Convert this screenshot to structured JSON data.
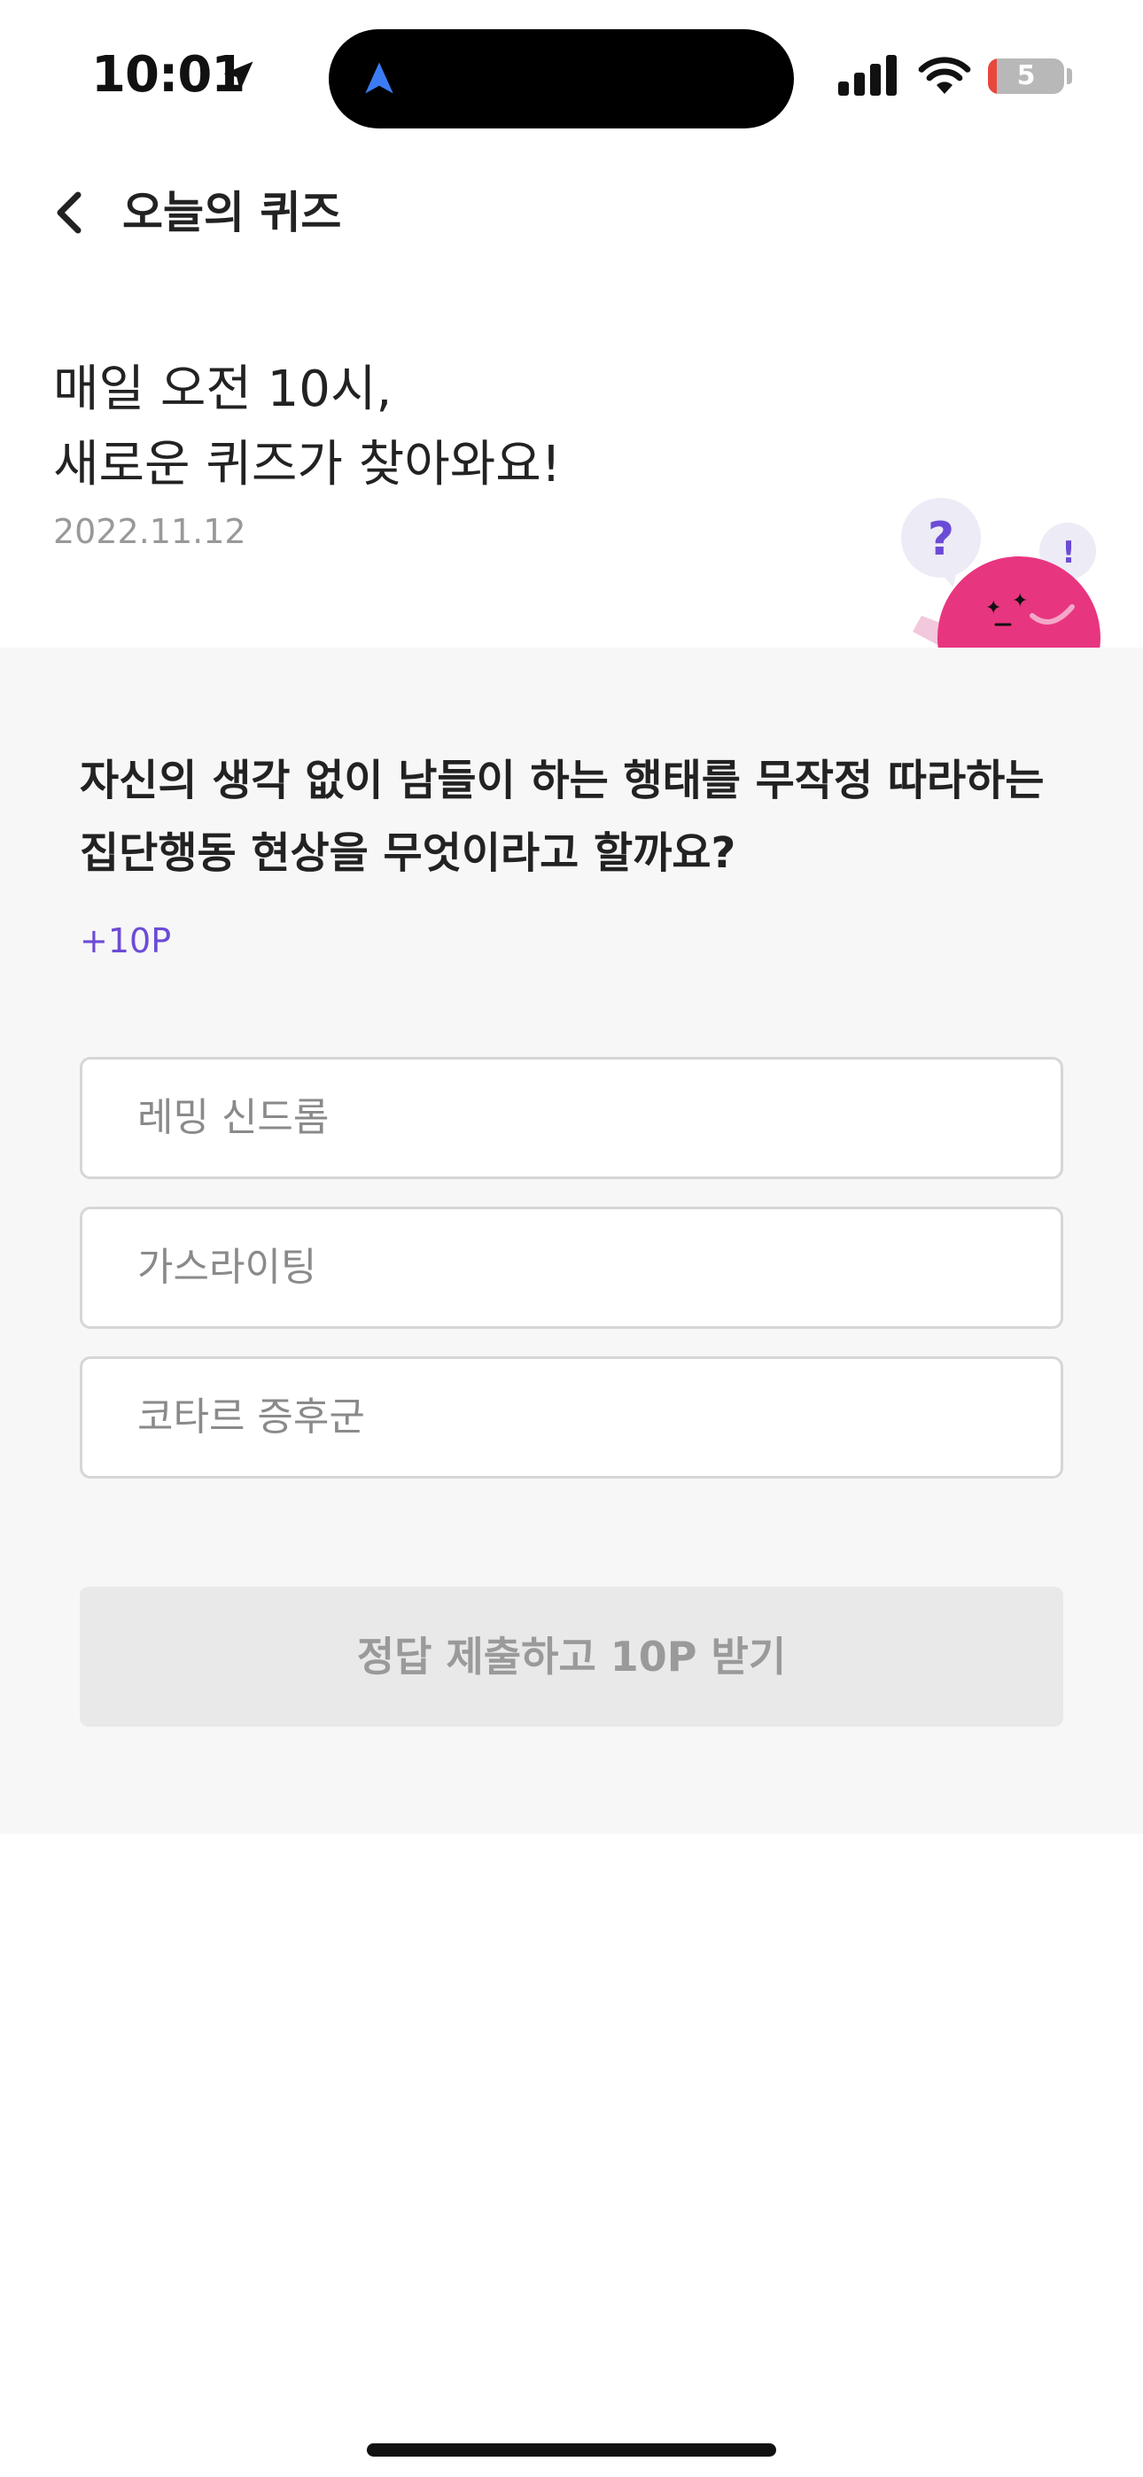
{
  "status_bar": {
    "time": "10:01",
    "battery_level": "5",
    "icons": [
      "location-arrow-icon",
      "navigation-arrow-icon",
      "cellular-signal-icon",
      "wifi-icon",
      "battery-icon"
    ]
  },
  "header": {
    "back_icon": "chevron-left-icon",
    "title": "오늘의 퀴즈"
  },
  "intro": {
    "line1": "매일 오전 10시,",
    "line2": "새로운 퀴즈가 찾아와요!",
    "date": "2022.11.12"
  },
  "mascot": {
    "icon": "quiz-mascot-illustration",
    "question_mark": "?",
    "exclamation_mark": "!"
  },
  "quiz": {
    "question": "자신의 생각 없이 남들이 하는 행태를 무작정 따라하는 집단행동 현상을 무엇이라고 할까요?",
    "points": "+10P",
    "options": [
      {
        "label": "레밍 신드롬"
      },
      {
        "label": "가스라이팅"
      },
      {
        "label": "코타르 증후군"
      }
    ],
    "submit_label": "정답 제출하고 10P 받기"
  },
  "colors": {
    "accent_purple": "#6b4bd6",
    "mascot_pink": "#e8357f",
    "panel_bg": "#f7f7f7",
    "nav_blue": "#3b7cf5"
  }
}
